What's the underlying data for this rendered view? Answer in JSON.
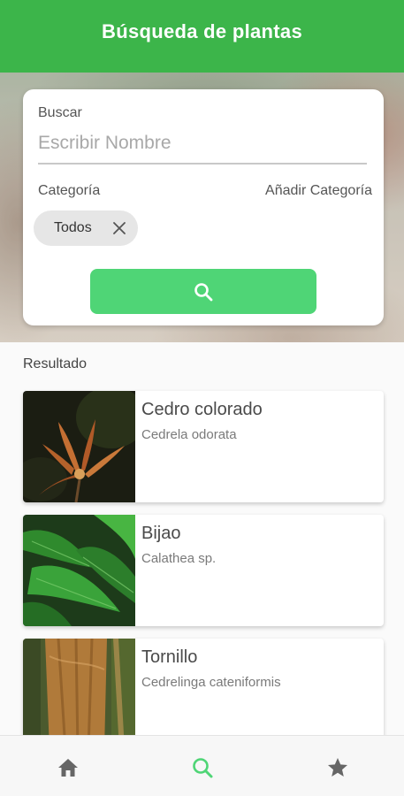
{
  "app_bar": {
    "title": "Búsqueda de plantas"
  },
  "search": {
    "label": "Buscar",
    "placeholder": "Escribir Nombre",
    "value": "",
    "category_label": "Categoría",
    "add_category_label": "Añadir Categoría",
    "chips": [
      {
        "label": "Todos"
      }
    ],
    "button_icon": "search-icon"
  },
  "results": {
    "title": "Resultado",
    "items": [
      {
        "name": "Cedro colorado",
        "scientific": "Cedrela odorata",
        "image": "orange-flower-photo"
      },
      {
        "name": "Bijao",
        "scientific": "Calathea sp.",
        "image": "green-leaves-photo"
      },
      {
        "name": "Tornillo",
        "scientific": "Cedrelinga cateniformis",
        "image": "tree-trunk-photo"
      }
    ]
  },
  "bottom_nav": {
    "items": [
      {
        "icon": "home-icon",
        "active": false
      },
      {
        "icon": "search-icon",
        "active": true
      },
      {
        "icon": "star-icon",
        "active": false
      }
    ]
  },
  "colors": {
    "primary": "#3cb54a",
    "button": "#4fd576",
    "active_nav": "#4fd576",
    "inactive_nav": "#666666"
  }
}
